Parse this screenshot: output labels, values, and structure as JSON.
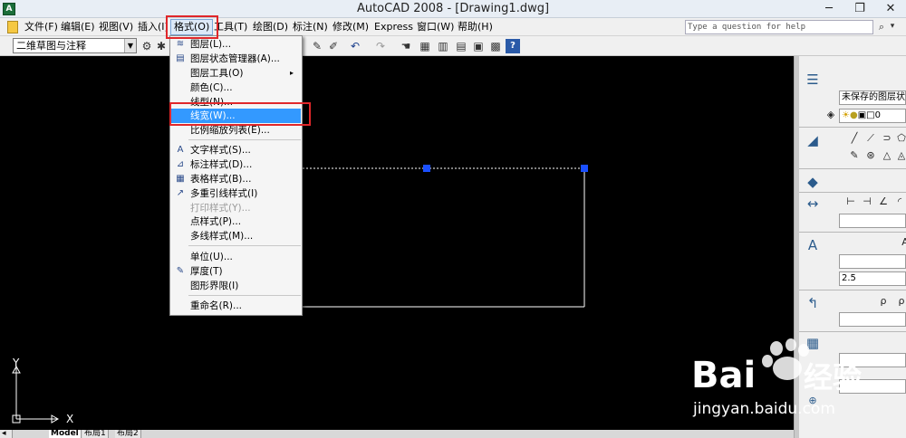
{
  "window": {
    "title": "AutoCAD 2008 - [Drawing1.dwg]",
    "minimize": "─",
    "restore": "❐",
    "close": "✕"
  },
  "menubar": {
    "items": [
      "文件(F)",
      "编辑(E)",
      "视图(V)",
      "插入(I)",
      "格式(O)",
      "工具(T)",
      "绘图(D)",
      "标注(N)",
      "修改(M)",
      "Express",
      "窗口(W)",
      "帮助(H)"
    ],
    "help_placeholder": "Type a question for help",
    "search_icon": "⌕",
    "search_arrow": "▾"
  },
  "toolbar": {
    "workspace": "二维草图与注释"
  },
  "format_menu": {
    "items": [
      {
        "label": "图层(L)...",
        "icon": "layers-icon"
      },
      {
        "label": "图层状态管理器(A)...",
        "icon": "layer-states-icon"
      },
      {
        "label": "图层工具(O)",
        "submenu": "▸"
      },
      {
        "label": "颜色(C)..."
      },
      {
        "label": "线型(N)..."
      },
      {
        "label": "线宽(W)...",
        "highlighted": true
      },
      {
        "label": "比例缩放列表(E)..."
      },
      {
        "label": "文字样式(S)...",
        "icon": "text-style-icon"
      },
      {
        "label": "标注样式(D)...",
        "icon": "dim-style-icon"
      },
      {
        "label": "表格样式(B)...",
        "icon": "table-style-icon"
      },
      {
        "label": "多重引线样式(I)",
        "icon": "mleader-style-icon"
      },
      {
        "label": "打印样式(Y)...",
        "disabled": true
      },
      {
        "label": "点样式(P)..."
      },
      {
        "label": "多线样式(M)..."
      },
      {
        "label": "单位(U)..."
      },
      {
        "label": "厚度(T)",
        "icon": "thickness-icon"
      },
      {
        "label": "图形界限(I)"
      },
      {
        "label": "重命名(R)..."
      }
    ]
  },
  "right_panel": {
    "layer_state": "未保存的图层状态",
    "layer_value": "0",
    "text_height": "2.5"
  },
  "ucs": {
    "x": "X",
    "y": "Y"
  },
  "tabs": [
    "Model",
    "布局1",
    "布局2"
  ],
  "watermark": {
    "brand": "Bai",
    "brand2": "经验",
    "url": "jingyan.baidu.com"
  },
  "colors": {
    "canvas": "#000000",
    "highlight": "#3399ff",
    "annotation": "#e0272a",
    "grip": "#1a4fff"
  }
}
